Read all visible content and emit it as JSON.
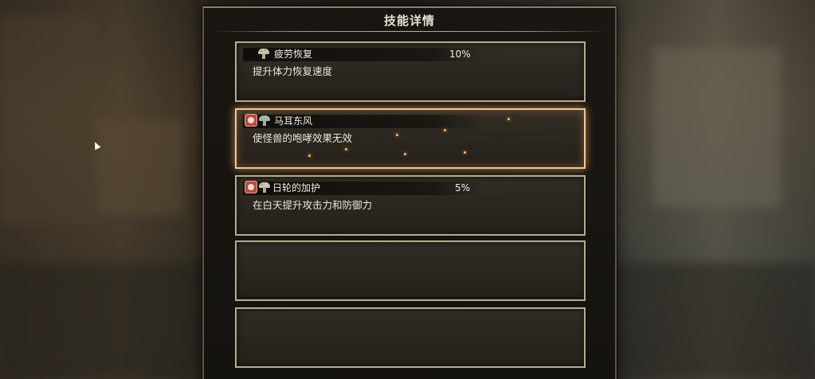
{
  "panel": {
    "title": "技能详情"
  },
  "skills": [
    {
      "name": "疲劳恢复",
      "percent": "10%",
      "description": "提升体力恢复速度",
      "icons": [
        "mushroom-icon"
      ]
    },
    {
      "name": "马耳东风",
      "percent": "",
      "description": "使怪兽的咆哮效果无效",
      "icons": [
        "red-badge-icon",
        "mushroom-icon"
      ]
    },
    {
      "name": "日轮的加护",
      "percent": "5%",
      "description": "在白天提升攻击力和防御力",
      "icons": [
        "red-badge-icon",
        "mushroom-icon"
      ]
    },
    {
      "name": "",
      "percent": "",
      "description": "",
      "icons": []
    },
    {
      "name": "",
      "percent": "",
      "description": "",
      "icons": []
    }
  ],
  "colors": {
    "active_glow": "#e9c9a0",
    "slot_border": "#b7ab94",
    "badge_red": "#b84a3e"
  }
}
